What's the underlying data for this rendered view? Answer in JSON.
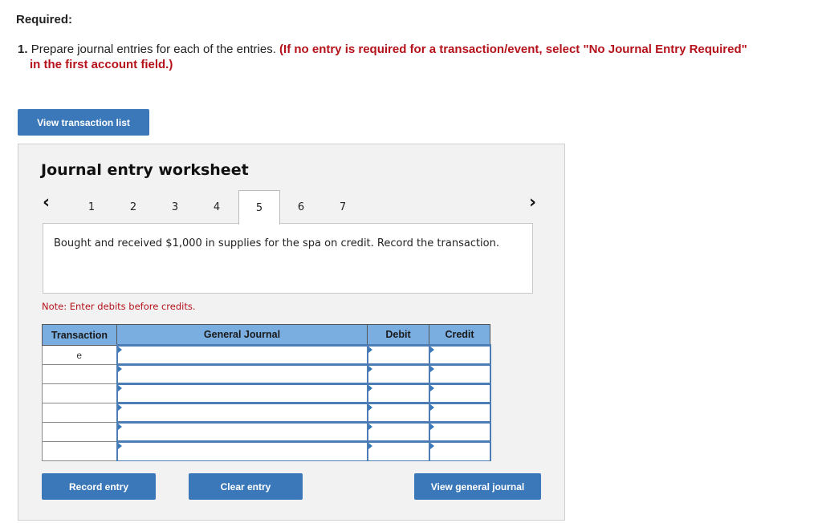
{
  "header": {
    "required_label": "Required:",
    "instruction_number": "1.",
    "instruction_text": "Prepare journal entries for each of the entries.",
    "instruction_red_line1": "(If no entry is required for a transaction/event, select \"No Journal Entry Required\"",
    "instruction_red_line2": "in the first account field.)"
  },
  "view_transaction_list_label": "View transaction list",
  "worksheet": {
    "title": "Journal entry worksheet",
    "prev_icon": "chevron-left-icon",
    "next_icon": "chevron-right-icon",
    "tabs": [
      {
        "label": "1",
        "active": false
      },
      {
        "label": "2",
        "active": false
      },
      {
        "label": "3",
        "active": false
      },
      {
        "label": "4",
        "active": false
      },
      {
        "label": "5",
        "active": true
      },
      {
        "label": "6",
        "active": false
      },
      {
        "label": "7",
        "active": false
      }
    ],
    "description": "Bought and received $1,000 in supplies for the spa on credit. Record the transaction.",
    "note": "Note: Enter debits before credits.",
    "table": {
      "headers": [
        "Transaction",
        "General Journal",
        "Debit",
        "Credit"
      ],
      "rows": [
        {
          "transaction": "e",
          "account": "",
          "debit": "",
          "credit": ""
        },
        {
          "transaction": "",
          "account": "",
          "debit": "",
          "credit": ""
        },
        {
          "transaction": "",
          "account": "",
          "debit": "",
          "credit": ""
        },
        {
          "transaction": "",
          "account": "",
          "debit": "",
          "credit": ""
        },
        {
          "transaction": "",
          "account": "",
          "debit": "",
          "credit": ""
        },
        {
          "transaction": "",
          "account": "",
          "debit": "",
          "credit": ""
        }
      ]
    },
    "buttons": {
      "record": "Record entry",
      "clear": "Clear entry",
      "view_general_journal": "View general journal"
    }
  },
  "colors": {
    "button_blue": "#3b78b9",
    "header_blue": "#7aaee0",
    "alert_red": "#b5121b"
  }
}
